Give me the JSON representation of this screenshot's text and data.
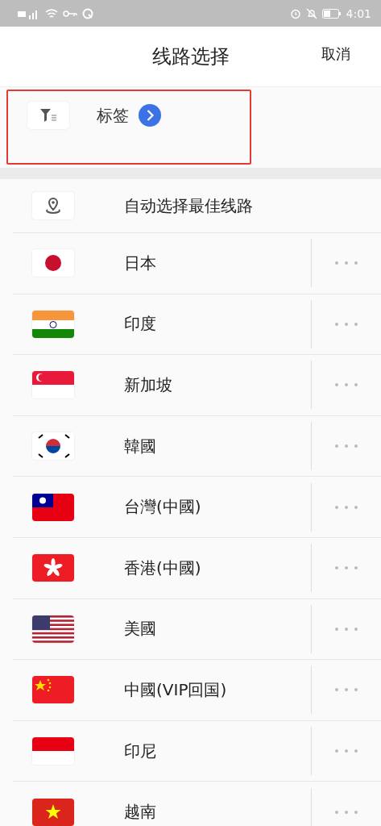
{
  "status_bar": {
    "time": "4:01"
  },
  "header": {
    "title": "线路选择",
    "cancel": "取消"
  },
  "tag_filter": {
    "label": "标签",
    "highlighted": true
  },
  "auto_route": {
    "label": "自动选择最佳线路"
  },
  "routes": [
    {
      "name": "日本",
      "kind": "jp"
    },
    {
      "name": "印度",
      "kind": "in"
    },
    {
      "name": "新加坡",
      "kind": "sg"
    },
    {
      "name": "韓國",
      "kind": "kr"
    },
    {
      "name": "台灣(中國)",
      "kind": "tw"
    },
    {
      "name": "香港(中國)",
      "kind": "hk"
    },
    {
      "name": "美國",
      "kind": "us"
    },
    {
      "name": "中國(VIP回国)",
      "kind": "cn"
    },
    {
      "name": "印尼",
      "kind": "id"
    },
    {
      "name": "越南",
      "kind": "vn"
    }
  ]
}
